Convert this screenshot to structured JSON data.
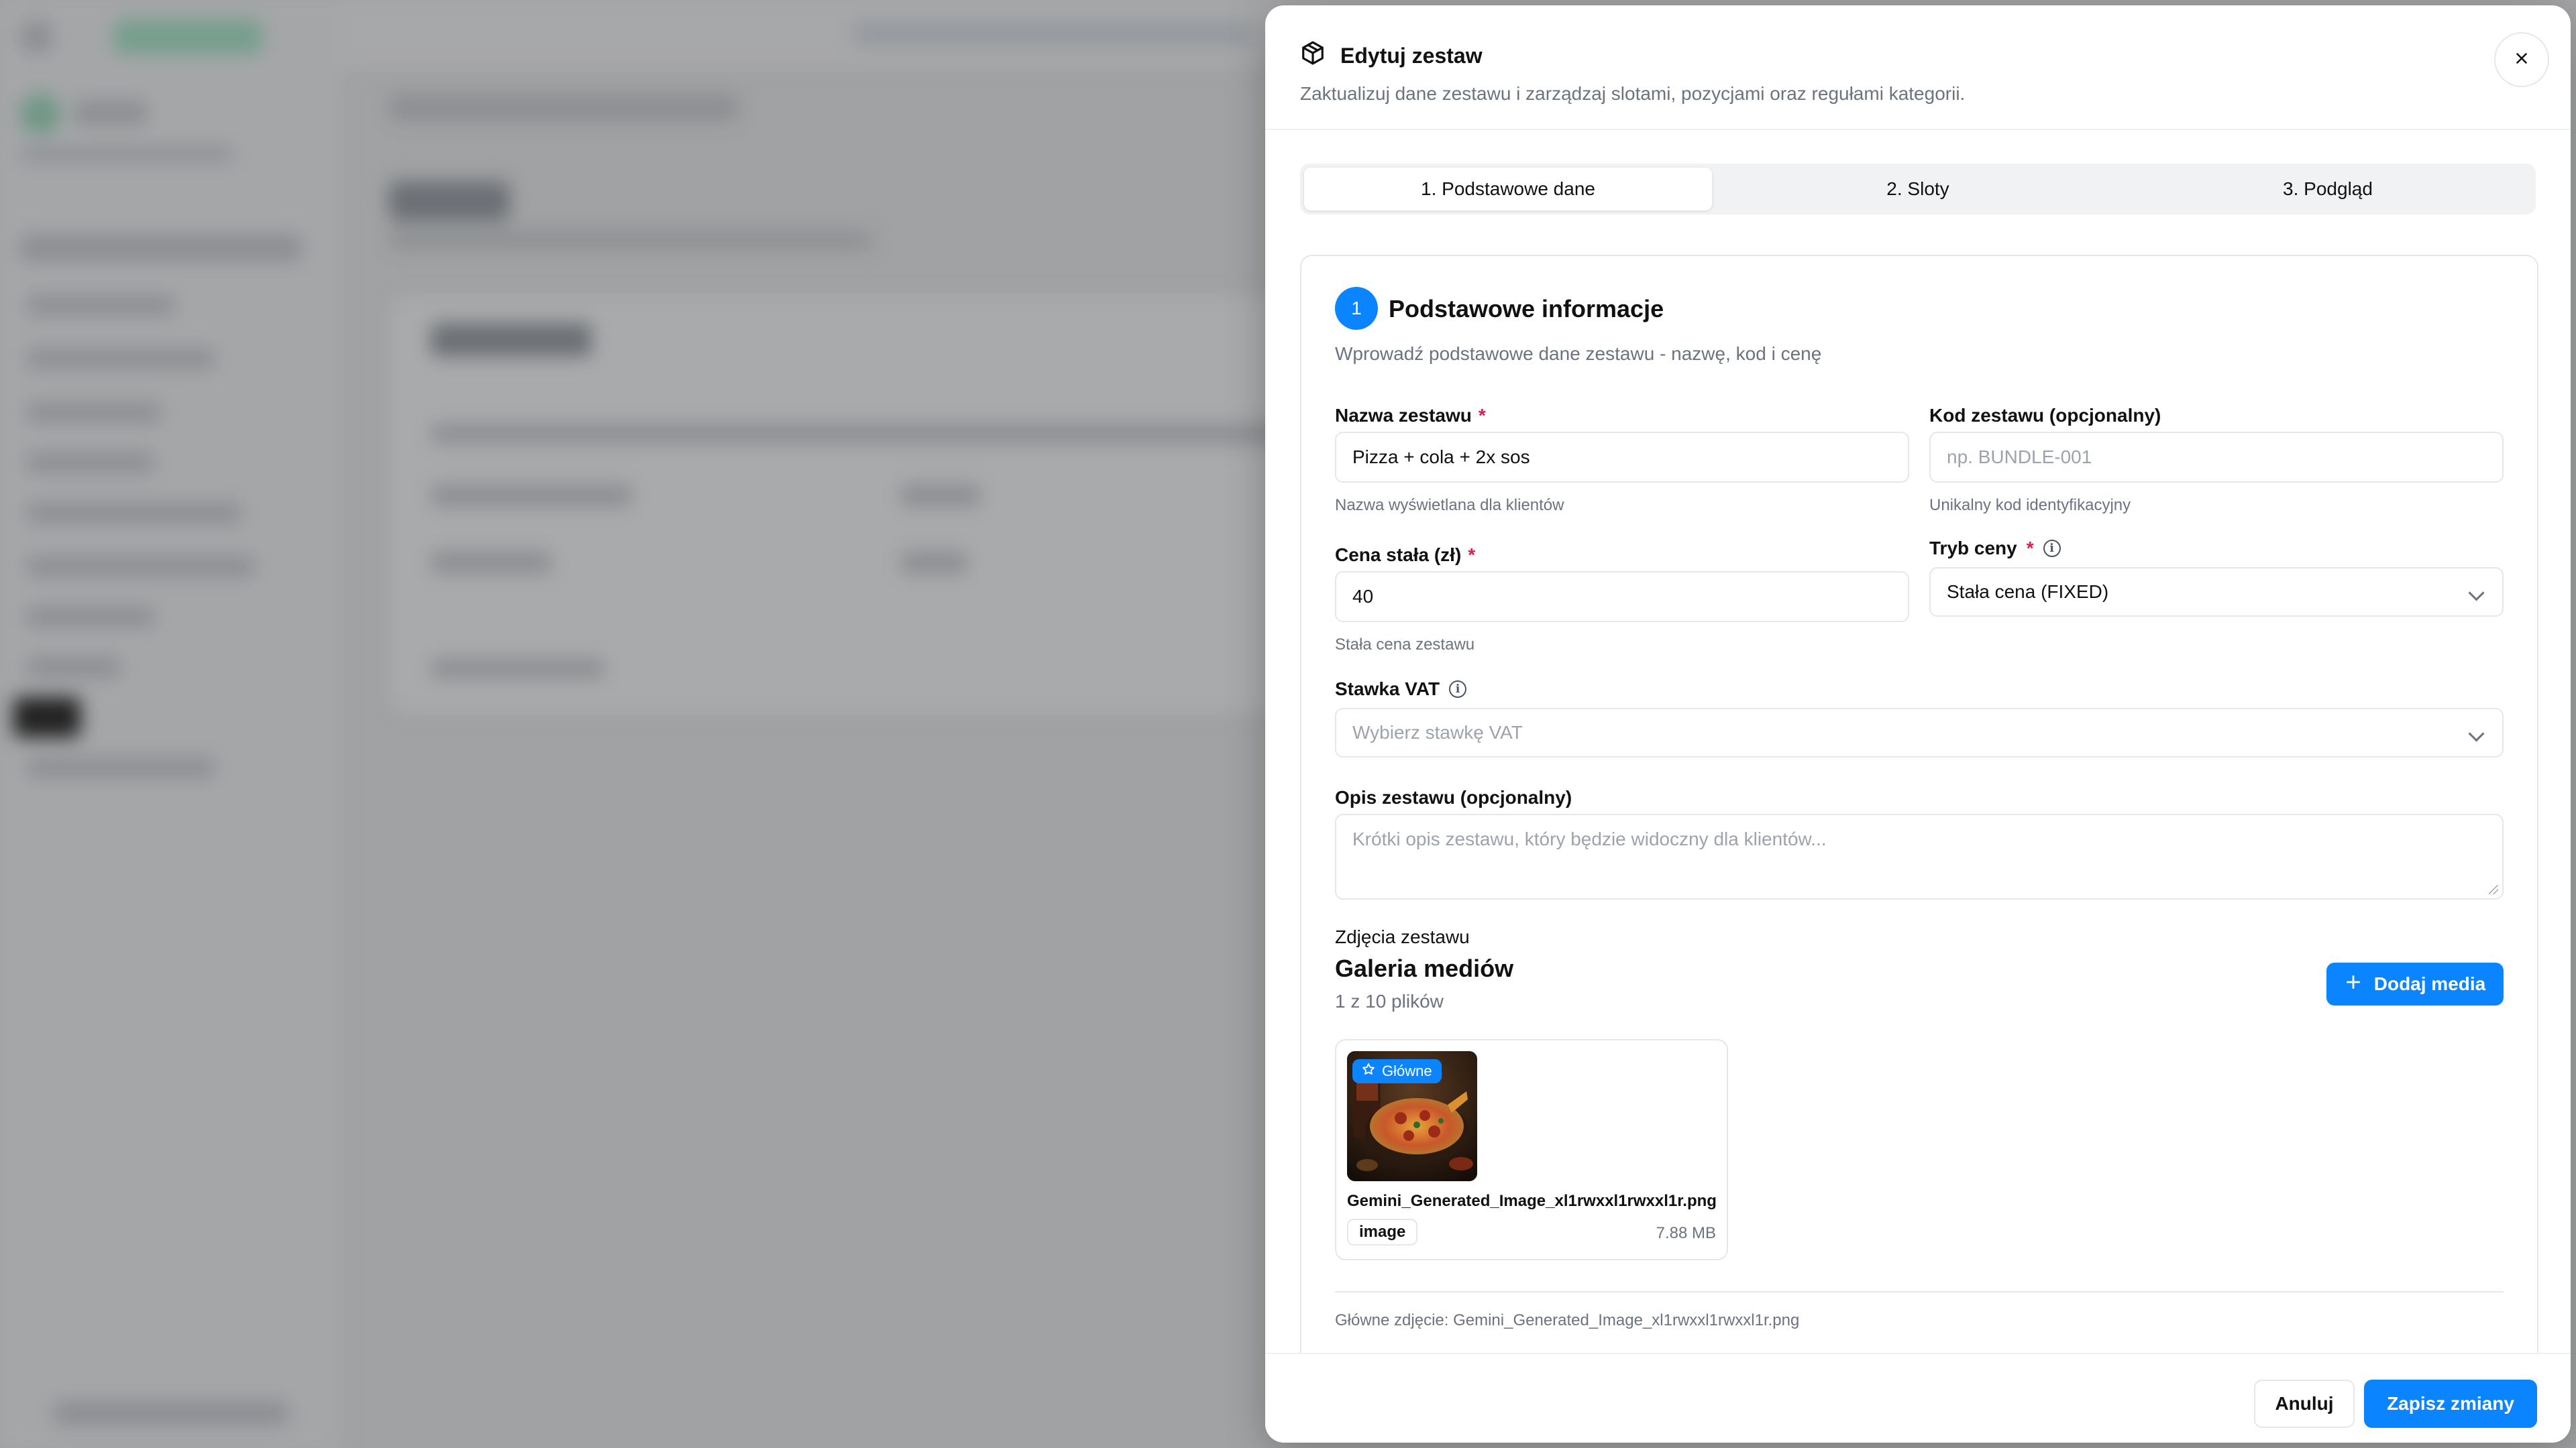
{
  "drawer": {
    "title": "Edytuj zestaw",
    "subtitle": "Zaktualizuj dane zestawu i zarządzaj slotami, pozycjami oraz regułami kategorii."
  },
  "tabs": [
    {
      "label": "1. Podstawowe dane",
      "active": true
    },
    {
      "label": "2. Sloty",
      "active": false
    },
    {
      "label": "3. Podgląd",
      "active": false
    }
  ],
  "section": {
    "step": "1",
    "title": "Podstawowe informacje",
    "subtitle": "Wprowadź podstawowe dane zestawu - nazwę, kod i cenę"
  },
  "fields": {
    "name": {
      "label": "Nazwa zestawu",
      "required": "*",
      "value": "Pizza + cola + 2x sos",
      "hint": "Nazwa wyświetlana dla klientów"
    },
    "code": {
      "label": "Kod zestawu (opcjonalny)",
      "placeholder": "np. BUNDLE-001",
      "hint": "Unikalny kod identyfikacyjny"
    },
    "price": {
      "label": "Cena stała (zł)",
      "required": "*",
      "value": "40",
      "hint": "Stała cena zestawu"
    },
    "price_mode": {
      "label": "Tryb ceny",
      "required": "*",
      "value": "Stała cena (FIXED)"
    },
    "vat": {
      "label": "Stawka VAT",
      "placeholder": "Wybierz stawkę VAT"
    },
    "description": {
      "label": "Opis zestawu (opcjonalny)",
      "placeholder": "Krótki opis zestawu, który będzie widoczny dla klientów..."
    }
  },
  "media": {
    "section_label": "Zdjęcia zestawu",
    "gallery_title": "Galeria mediów",
    "count": "1 z 10 plików",
    "add_button": "Dodaj media",
    "items": [
      {
        "badge": "Główne",
        "file_name": "Gemini_Generated_Image_xl1rwxxl1rwxxl1r.png",
        "type": "image",
        "size": "7.88 MB"
      }
    ],
    "main_photo": "Główne zdjęcie: Gemini_Generated_Image_xl1rwxxl1rwxxl1r.png"
  },
  "footer": {
    "cancel": "Anuluj",
    "save": "Zapisz zmiany"
  },
  "colors": {
    "accent": "#0a84ff",
    "required": "#e11d48"
  },
  "icons": {
    "title": "package-icon",
    "close": "close-icon",
    "info": "info-icon",
    "add": "plus-icon",
    "badge": "star-icon"
  }
}
